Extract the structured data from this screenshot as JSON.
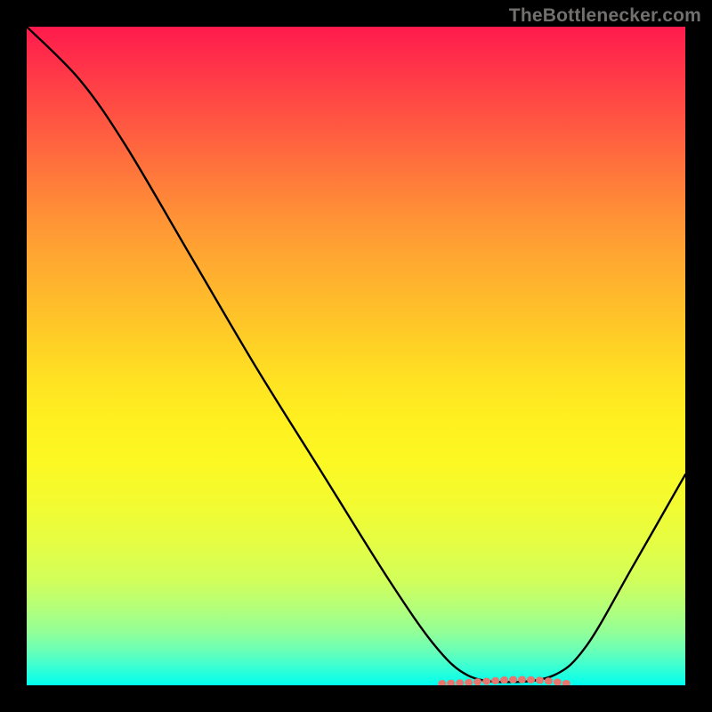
{
  "watermark": "TheBottlenecker.com",
  "chart_data": {
    "type": "line",
    "title": "",
    "xlabel": "",
    "ylabel": "",
    "xlim": [
      0,
      100
    ],
    "ylim": [
      0,
      100
    ],
    "grid": false,
    "series": [
      {
        "name": "curve",
        "color": "#000000",
        "points": [
          {
            "x": 0,
            "y": 100
          },
          {
            "x": 8,
            "y": 92
          },
          {
            "x": 15,
            "y": 82
          },
          {
            "x": 25,
            "y": 65
          },
          {
            "x": 35,
            "y": 48
          },
          {
            "x": 45,
            "y": 32
          },
          {
            "x": 55,
            "y": 16
          },
          {
            "x": 62,
            "y": 6
          },
          {
            "x": 67,
            "y": 1.5
          },
          {
            "x": 73,
            "y": 0.5
          },
          {
            "x": 80,
            "y": 1.5
          },
          {
            "x": 85,
            "y": 6
          },
          {
            "x": 92,
            "y": 18
          },
          {
            "x": 100,
            "y": 32
          }
        ]
      }
    ],
    "highlight": {
      "color": "#e8766f",
      "range_x": [
        63,
        82
      ],
      "y": 0.8
    }
  }
}
